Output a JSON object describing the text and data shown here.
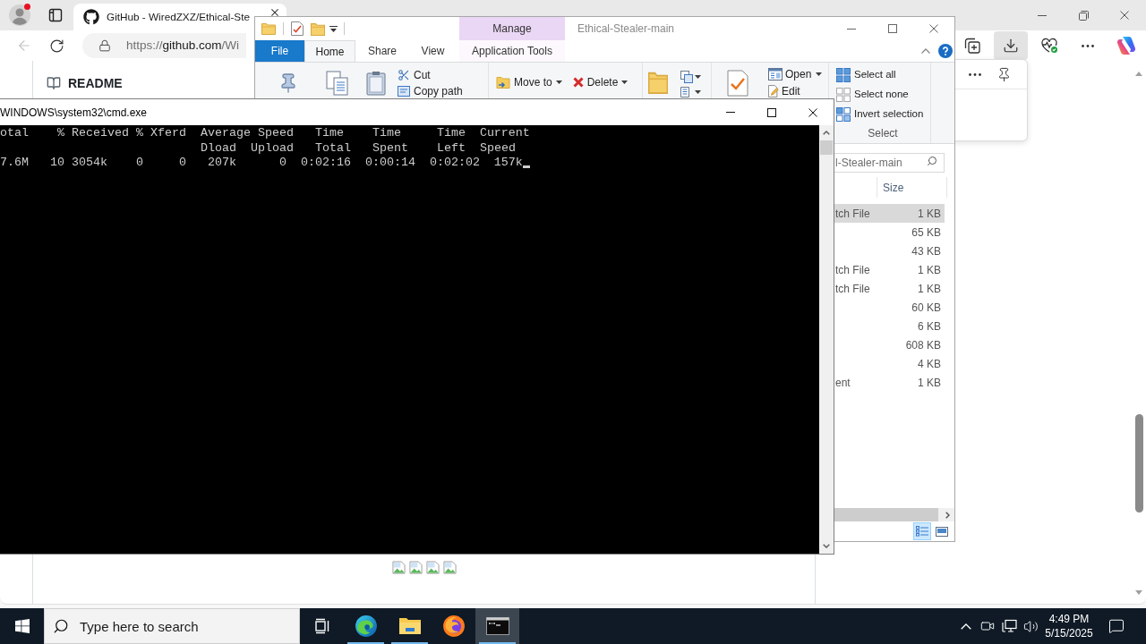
{
  "browser": {
    "profile": {
      "notification": true
    },
    "tab": {
      "title": "GitHub - WiredZXZ/Ethical-Ste",
      "selected": true
    },
    "back": {
      "disabled": true
    },
    "address": [
      {
        "text": "https://",
        "strong": false
      },
      {
        "text": "github.com",
        "strong": true
      },
      {
        "text": "/Wi",
        "strong": false
      }
    ],
    "toolbar": [
      {
        "kind": "collections",
        "pressed": false
      },
      {
        "kind": "downloads",
        "pressed": true
      },
      {
        "kind": "health",
        "pressed": false
      },
      {
        "kind": "more",
        "pressed": false
      },
      {
        "kind": "copilot",
        "pressed": false
      }
    ],
    "page": {
      "heading": "README",
      "images": [
        {
          "kind": "broken"
        },
        {
          "kind": "broken"
        },
        {
          "kind": "broken"
        },
        {
          "kind": "broken"
        }
      ]
    }
  },
  "explorer": {
    "title": "Ethical-Stealer-main",
    "context_header": "Manage",
    "tabs": [
      {
        "label": "File",
        "kind": "file",
        "selected": false
      },
      {
        "label": "Home",
        "kind": "tab",
        "selected": true
      },
      {
        "label": "Share",
        "kind": "tab",
        "selected": false
      },
      {
        "label": "View",
        "kind": "tab",
        "selected": false
      },
      {
        "label": "Application Tools",
        "kind": "context",
        "selected": false
      }
    ],
    "clipboard": [
      {
        "kind": "cut",
        "label": "Cut"
      },
      {
        "kind": "copy_path",
        "label": "Copy path"
      }
    ],
    "organize": [
      {
        "kind": "move",
        "label": "Move to",
        "dropdown": true
      },
      {
        "kind": "delete",
        "label": "Delete",
        "dropdown": true
      }
    ],
    "open": [
      {
        "kind": "open",
        "label": "Open",
        "dropdown": true
      },
      {
        "kind": "edit",
        "label": "Edit",
        "dropdown": false
      }
    ],
    "select": {
      "label": "Select",
      "items": [
        {
          "kind": "all",
          "label": "Select all"
        },
        {
          "kind": "none",
          "label": "Select none"
        },
        {
          "kind": "invert",
          "label": "Invert selection"
        }
      ]
    },
    "search": {
      "placeholder": "l-Stealer-main"
    },
    "columns": [
      {
        "label": "Size"
      }
    ],
    "files": [
      {
        "type": "tch File",
        "size": "1 KB",
        "selected": true
      },
      {
        "size": "65 KB",
        "selected": false
      },
      {
        "size": "43 KB",
        "selected": false
      },
      {
        "type": "tch File",
        "size": "1 KB",
        "selected": false
      },
      {
        "type": "tch File",
        "size": "1 KB",
        "selected": false
      },
      {
        "size": "60 KB",
        "selected": false
      },
      {
        "size": "6 KB",
        "selected": false
      },
      {
        "size": "608 KB",
        "selected": false
      },
      {
        "size": "4 KB",
        "selected": false
      },
      {
        "type": "ent",
        "size": "1 KB",
        "selected": false
      }
    ],
    "views": [
      {
        "kind": "details",
        "selected": true
      },
      {
        "kind": "large_icons",
        "selected": false
      }
    ]
  },
  "console": {
    "title": "WINDOWS\\system32\\cmd.exe",
    "lines": [
      "otal    % Received % Xferd  Average Speed   Time    Time     Time  Current",
      "                            Dload  Upload   Total   Spent    Left  Speed",
      "7.6M   10 3054k    0     0   207k      0  0:02:16  0:00:14  0:02:02  157k"
    ],
    "cursor": true
  },
  "taskbar": {
    "search": {
      "placeholder": "Type here to search"
    },
    "apps": [
      {
        "kind": "edge",
        "running": true,
        "selected": false
      },
      {
        "kind": "explorer",
        "running": true,
        "selected": false
      },
      {
        "kind": "firefox",
        "running": false,
        "selected": false
      },
      {
        "kind": "terminal",
        "running": true,
        "selected": true
      }
    ],
    "clock": {
      "time": "4:49 PM",
      "date": "5/15/2025"
    }
  }
}
